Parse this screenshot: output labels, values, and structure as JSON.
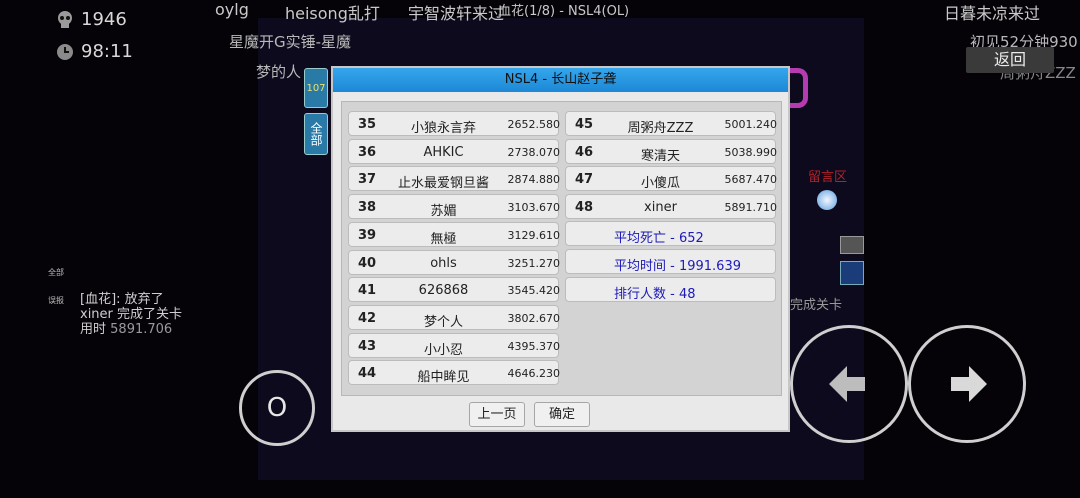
{
  "hud": {
    "deaths": "1946",
    "time": "98:11"
  },
  "top_names": [
    "oylg",
    "heisong乱打",
    "宇智波轩来过",
    "血花(1/8) - NSL4(OL)",
    "日暮未凉来过"
  ],
  "chat": {
    "line1": "星魔开G实锤-星魔",
    "line2": "梦的人",
    "line3": "初见52分钟930",
    "line4": "周粥舟ZZZ"
  },
  "back_label": "返回",
  "tiny_labels": [
    "全部",
    "误报"
  ],
  "log": {
    "line1": "[血花]: 放弃了",
    "line2": "xiner 完成了关卡",
    "line3_prefix": "用时",
    "line3_time": "5891.706"
  },
  "bg_text": {
    "right1": "留言区",
    "right2": "完成关卡"
  },
  "side_tabs": {
    "count": "107",
    "all": "全部"
  },
  "dialog": {
    "title": "NSL4 - 长山赵子聋",
    "left_rows": [
      {
        "rank": "35",
        "name": "小狼永言弃",
        "score": "2652.580"
      },
      {
        "rank": "36",
        "name": "AHKIC",
        "score": "2738.070"
      },
      {
        "rank": "37",
        "name": "止水最爱钢旦酱",
        "score": "2874.880"
      },
      {
        "rank": "38",
        "name": "苏媚",
        "score": "3103.670"
      },
      {
        "rank": "39",
        "name": "無極",
        "score": "3129.610"
      },
      {
        "rank": "40",
        "name": "ohls",
        "score": "3251.270"
      },
      {
        "rank": "41",
        "name": "626868",
        "score": "3545.420"
      },
      {
        "rank": "42",
        "name": "梦个人",
        "score": "3802.670"
      },
      {
        "rank": "43",
        "name": "小小忍",
        "score": "4395.370"
      },
      {
        "rank": "44",
        "name": "船中眸见",
        "score": "4646.230"
      }
    ],
    "right_rows": [
      {
        "rank": "45",
        "name": "周粥舟ZZZ",
        "score": "5001.240"
      },
      {
        "rank": "46",
        "name": "寒清天",
        "score": "5038.990"
      },
      {
        "rank": "47",
        "name": "小傻瓜",
        "score": "5687.470"
      },
      {
        "rank": "48",
        "name": "xiner",
        "score": "5891.710"
      }
    ],
    "stats": {
      "avg_deaths": "平均死亡 - 652",
      "avg_time": "平均时间 - 1991.639",
      "count": "排行人数 - 48"
    },
    "prev_label": "上一页",
    "ok_label": "确定"
  },
  "controls": {
    "action_label": "O"
  }
}
